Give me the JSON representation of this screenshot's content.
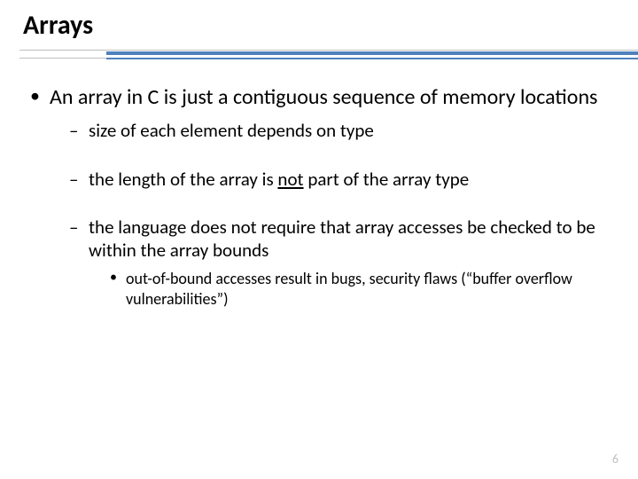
{
  "title": "Arrays",
  "bullets": {
    "main": "An array in C is just a contiguous sequence of memory locations",
    "sub1": "size of each element depends on type",
    "sub2a": "the length of the array is ",
    "sub2_not": "not",
    "sub2b": " part of the array type",
    "sub3": "the language does not require that array accesses be checked to be within the array bounds",
    "sub3_sub": "out-of-bound accesses result in bugs, security flaws (“buffer overflow vulnerabilities”)"
  },
  "page_number": "6"
}
